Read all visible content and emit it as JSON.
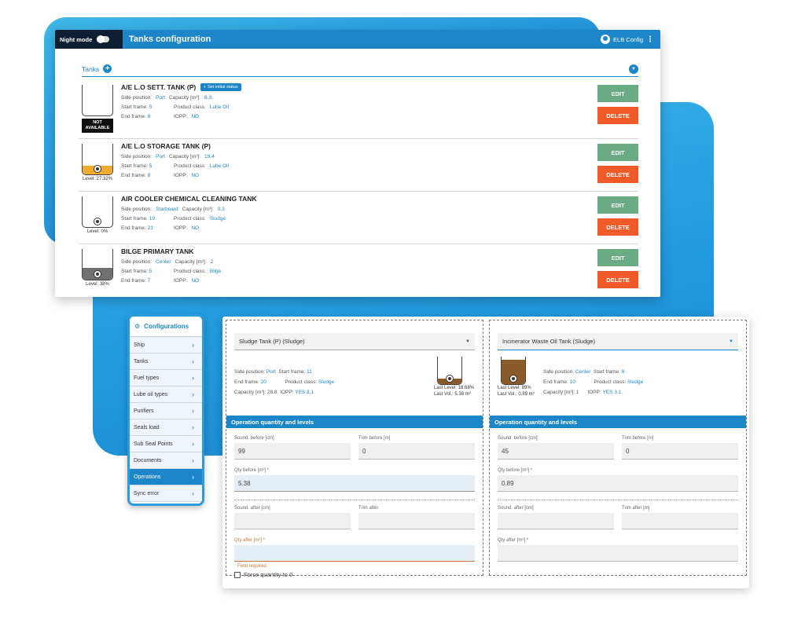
{
  "header": {
    "night_mode_label": "Night mode",
    "title": "Tanks configuration",
    "user_label": "ELB Config"
  },
  "tanks_section": {
    "label": "Tanks"
  },
  "tanks": [
    {
      "name": "A/E L.O SETT. TANK (P)",
      "init_badge": "Set initial status",
      "status_badge": "NOT AVAILABLE",
      "level_text": "",
      "fill_fraction": 0,
      "fill_color": "#ffffff",
      "side_label": "Side position:",
      "side": "Port",
      "cap_label": "Capacity [m³]:",
      "cap": "6.3",
      "start_label": "Start frame:",
      "start": "5",
      "class_label": "Product class:",
      "pclass": "Lube Oil",
      "end_label": "End frame:",
      "end": "8",
      "iopp_label": "IOPP:",
      "iopp": "NO"
    },
    {
      "name": "A/E L.O STORAGE TANK (P)",
      "level_text": "Level: 27.32%",
      "fill_fraction": 0.27,
      "fill_color": "#f0aa32",
      "side_label": "Side position:",
      "side": "Port",
      "cap_label": "Capacity [m³]:",
      "cap": "19.4",
      "start_label": "Start frame:",
      "start": "5",
      "class_label": "Product class:",
      "pclass": "Lube Oil",
      "end_label": "End frame:",
      "end": "8",
      "iopp_label": "IOPP:",
      "iopp": "NO"
    },
    {
      "name": "AIR COOLER CHEMICAL CLEANING TANK",
      "level_text": "Level: 0%",
      "fill_fraction": 0,
      "fill_color": "#ffffff",
      "side_label": "Side position:",
      "side": "Starboard",
      "cap_label": "Capacity [m³]:",
      "cap": "0.3",
      "start_label": "Start frame:",
      "start": "19",
      "class_label": "Product class:",
      "pclass": "Sludge",
      "end_label": "End frame:",
      "end": "21",
      "iopp_label": "IOPP:",
      "iopp": "NO"
    },
    {
      "name": "BILGE PRIMARY TANK",
      "level_text": "Level: 38%",
      "fill_fraction": 0.38,
      "fill_color": "#707070",
      "side_label": "Side position:",
      "side": "Center",
      "cap_label": "Capacity [m³]:",
      "cap": "2",
      "start_label": "Start frame:",
      "start": "5",
      "class_label": "Product class:",
      "pclass": "Bilge",
      "end_label": "End frame:",
      "end": "7",
      "iopp_label": "IOPP:",
      "iopp": "NO"
    }
  ],
  "buttons": {
    "edit": "EDIT",
    "delete": "DELETE"
  },
  "config_menu": {
    "title": "Configurations",
    "items": [
      {
        "label": "Ship"
      },
      {
        "label": "Tanks"
      },
      {
        "label": "Fuel types"
      },
      {
        "label": "Lube oil types"
      },
      {
        "label": "Purifiers"
      },
      {
        "label": "Seals load"
      },
      {
        "label": "Sub Seal Points"
      },
      {
        "label": "Documents"
      },
      {
        "label": "Operations",
        "active": true
      },
      {
        "label": "Sync error"
      }
    ]
  },
  "operations": {
    "band_label": "Operation quantity and levels",
    "left": {
      "tank_select": "Sludge Tank (P) (Sludge)",
      "side_label": "Side position:",
      "side": "Port",
      "start_label": "Start frame:",
      "start": "11",
      "end_label": "End frame:",
      "end": "20",
      "class_label": "Product class:",
      "pclass": "Sludge",
      "cap_label": "Capacity [m³]: 28.8",
      "iopp_label": "IOPP:",
      "iopp": "YES 3.1",
      "last_level": "Last Level: 18.68%",
      "last_vol": "Last Vol.: 5.38 m³",
      "fill_fraction": 0.19,
      "fill_color": "#8b5a2b",
      "sound_before_label": "Sound. before [cm]",
      "sound_before": "99",
      "trim_before_label": "Trim before [m]",
      "trim_before": "0",
      "qty_before_label": "Qty before [m³] *",
      "qty_before": "5.38",
      "sound_after_label": "Sound. after [cm]",
      "sound_after": "",
      "trim_after_label": "Trim after",
      "trim_after": "",
      "qty_after_label": "Qty after [m³] *",
      "qty_after": "",
      "error": "Field required",
      "force_label": "Force quantity to 0"
    },
    "right": {
      "tank_select": "Incinerator Waste Oil Tank (Sludge)",
      "side_label": "Side position:",
      "side": "Center",
      "start_label": "Start frame:",
      "start": "8",
      "end_label": "End frame:",
      "end": "10",
      "class_label": "Product class:",
      "pclass": "Sludge",
      "cap_label": "Capacity [m³]: 1",
      "iopp_label": "IOPP:",
      "iopp": "YES 3.1",
      "last_level": "Last Level: 89%",
      "last_vol": "Last Vol.: 0.89 m³",
      "fill_fraction": 0.89,
      "fill_color": "#8b5a2b",
      "sound_before_label": "Sound. before [cm]",
      "sound_before": "45",
      "trim_before_label": "Trim before [m]",
      "trim_before": "0",
      "qty_before_label": "Qty before [m³] *",
      "qty_before": "0.89",
      "sound_after_label": "Sound. after [cm]",
      "sound_after": "",
      "trim_after_label": "Trim after [m]",
      "trim_after": "",
      "qty_after_label": "Qty after [m³] *",
      "qty_after": ""
    }
  }
}
